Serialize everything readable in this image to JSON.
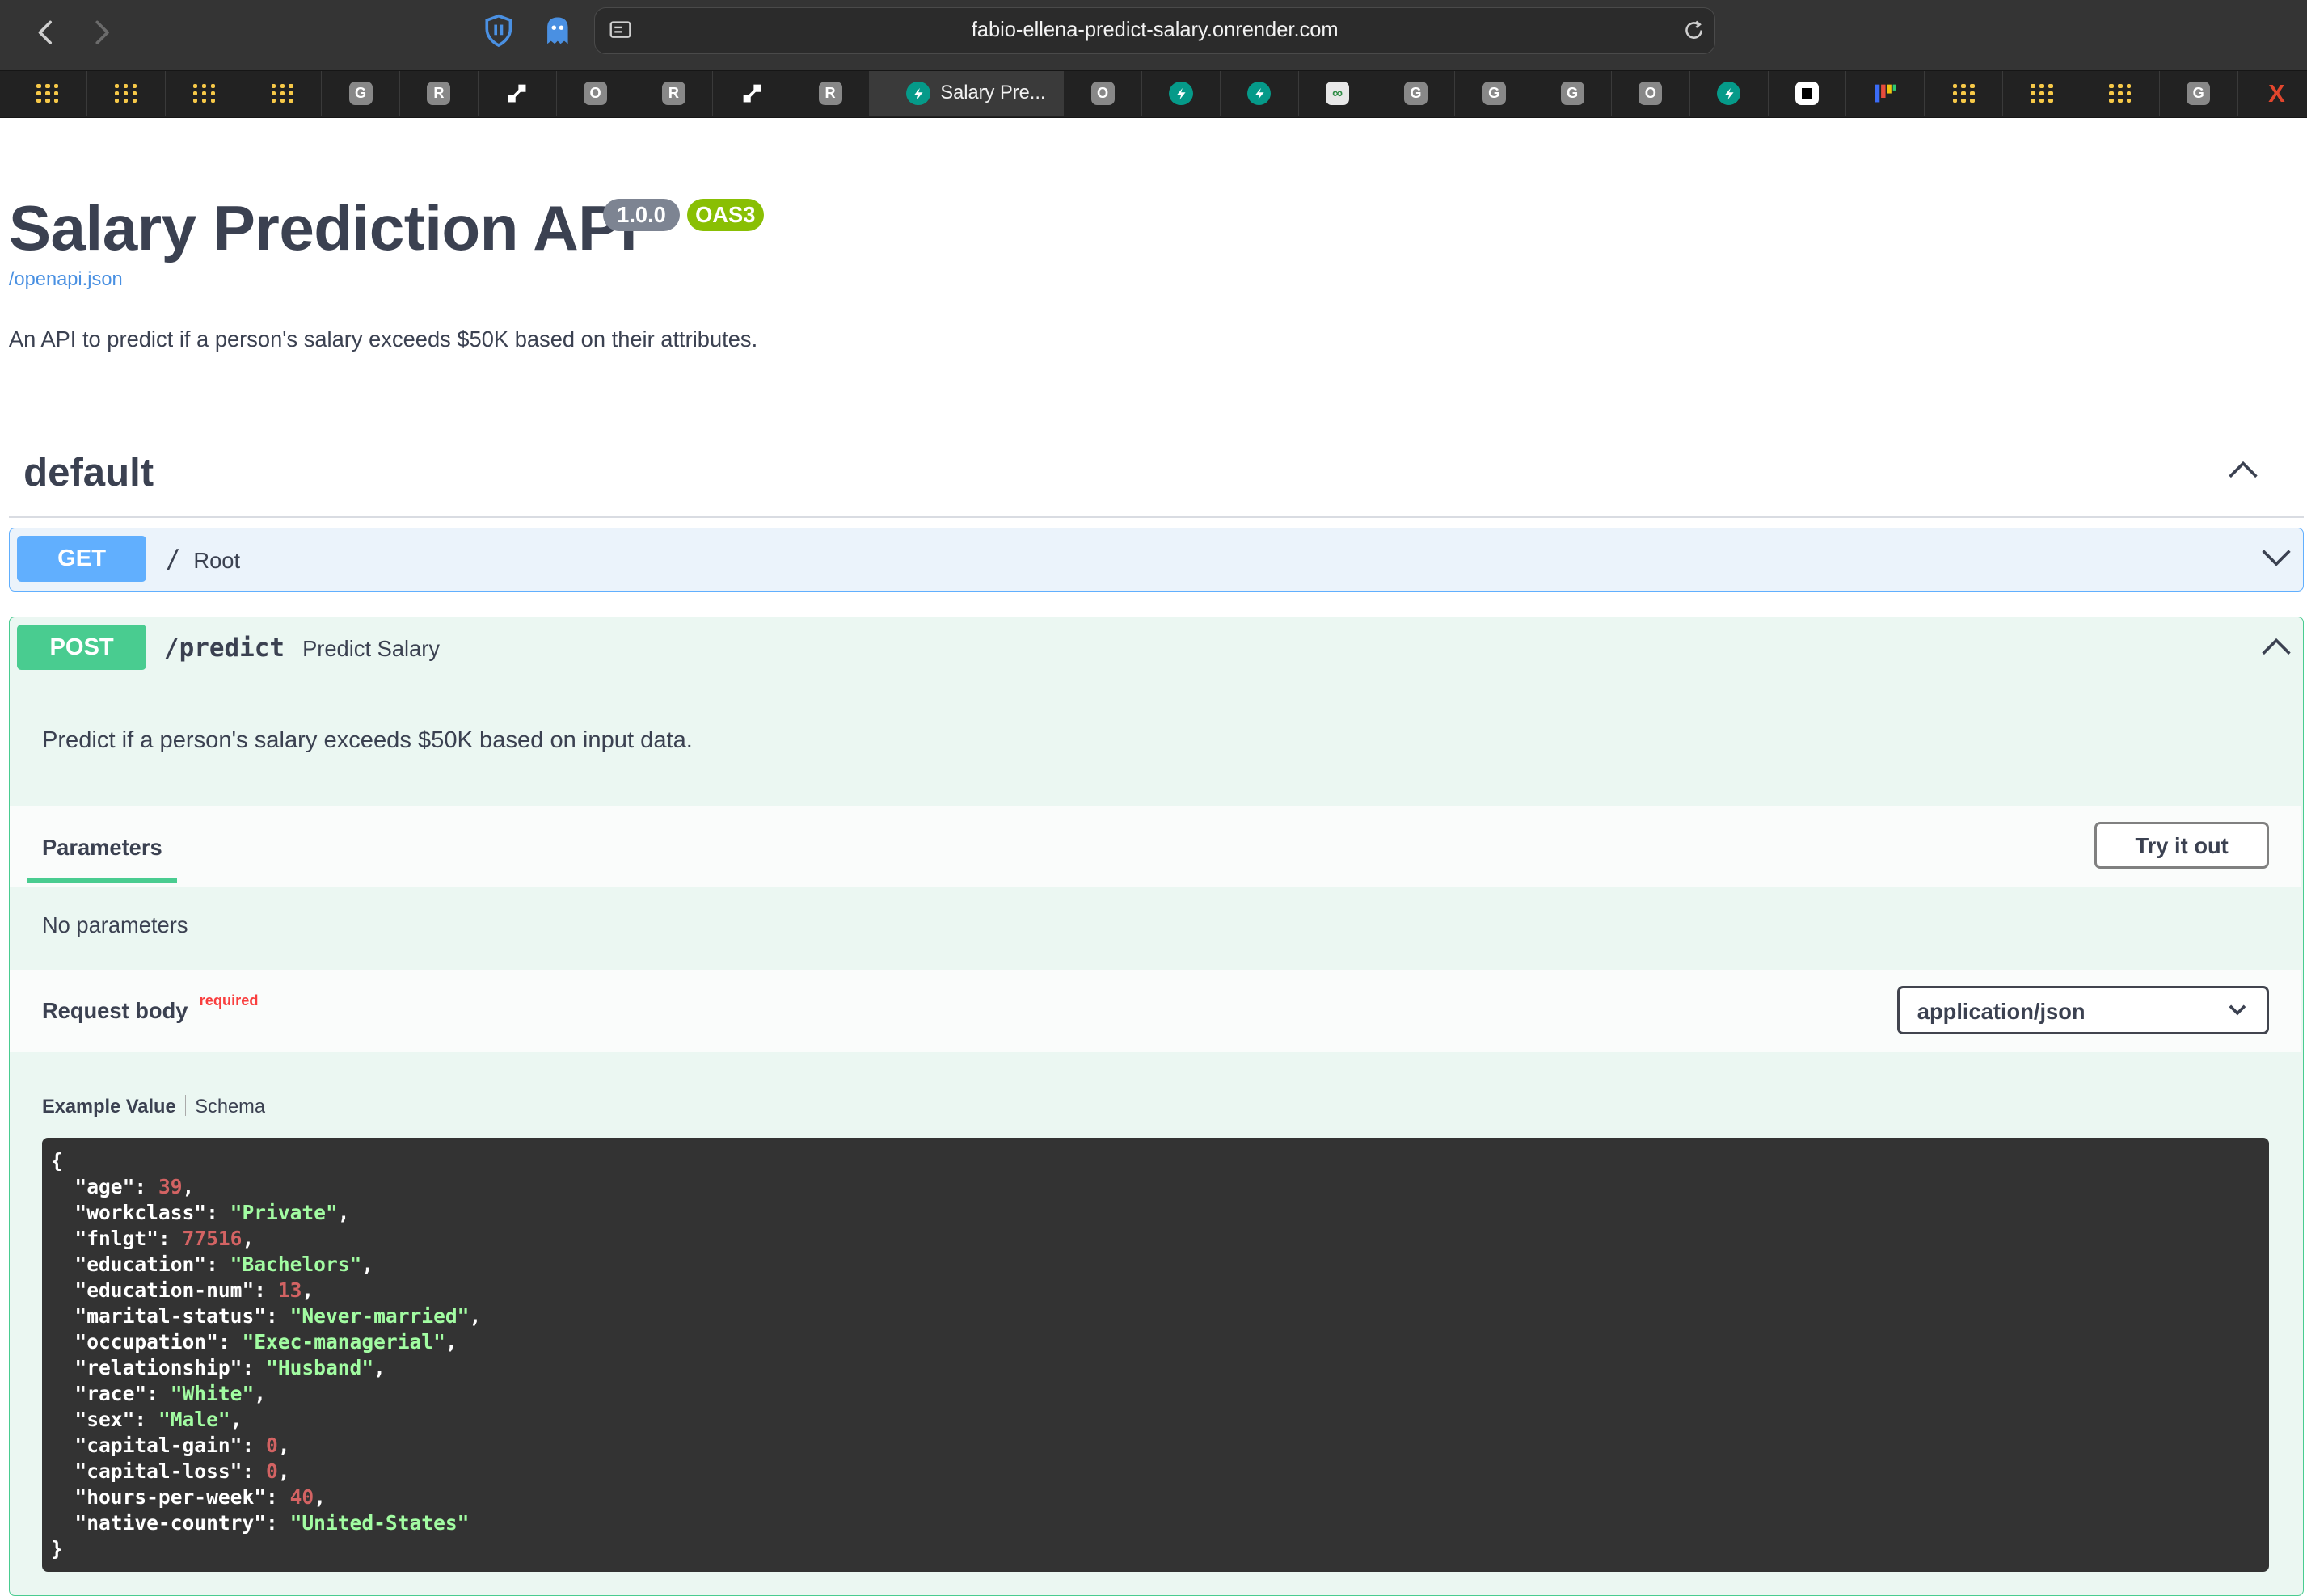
{
  "browser": {
    "url": "fabio-ellena-predict-salary.onrender.com",
    "tabs": [
      {
        "type": "dots"
      },
      {
        "type": "dots"
      },
      {
        "type": "dots"
      },
      {
        "type": "dots"
      },
      {
        "type": "letter",
        "text": "G"
      },
      {
        "type": "letter",
        "text": "R"
      },
      {
        "type": "link"
      },
      {
        "type": "letter",
        "text": "O"
      },
      {
        "type": "letter",
        "text": "R"
      },
      {
        "type": "link"
      },
      {
        "type": "letter",
        "text": "R"
      },
      {
        "type": "fastapi",
        "title": "Salary Pre...",
        "active": true
      },
      {
        "type": "letter",
        "text": "O"
      },
      {
        "type": "fastapi"
      },
      {
        "type": "fastapi"
      },
      {
        "type": "geeks"
      },
      {
        "type": "letter",
        "text": "G"
      },
      {
        "type": "letter",
        "text": "G"
      },
      {
        "type": "letter",
        "text": "G"
      },
      {
        "type": "letter",
        "text": "O"
      },
      {
        "type": "fastapi"
      },
      {
        "type": "square"
      },
      {
        "type": "bars"
      },
      {
        "type": "dots"
      },
      {
        "type": "dots"
      },
      {
        "type": "dots"
      },
      {
        "type": "letter",
        "text": "G"
      },
      {
        "type": "x",
        "text": "X"
      }
    ],
    "active_tab_title": "Salary Pre..."
  },
  "info": {
    "title": "Salary Prediction API",
    "version": "1.0.0",
    "oas": "OAS3",
    "spec_link": "/openapi.json",
    "description": "An API to predict if a person's salary exceeds $50K based on their attributes."
  },
  "section": {
    "title": "default"
  },
  "get_op": {
    "method": "GET",
    "path": "/",
    "summary": "Root"
  },
  "post_op": {
    "method": "POST",
    "path": "/predict",
    "summary": "Predict Salary",
    "description": "Predict if a person's salary exceeds $50K based on input data.",
    "parameters_tab": "Parameters",
    "try_it_out": "Try it out",
    "no_parameters": "No parameters",
    "request_body_label": "Request body",
    "required_label": "required",
    "content_type": "application/json",
    "example_tab": "Example Value",
    "schema_tab": "Schema",
    "example": [
      {
        "key": "age",
        "value": "39",
        "kind": "number"
      },
      {
        "key": "workclass",
        "value": "Private",
        "kind": "string"
      },
      {
        "key": "fnlgt",
        "value": "77516",
        "kind": "number"
      },
      {
        "key": "education",
        "value": "Bachelors",
        "kind": "string"
      },
      {
        "key": "education-num",
        "value": "13",
        "kind": "number"
      },
      {
        "key": "marital-status",
        "value": "Never-married",
        "kind": "string"
      },
      {
        "key": "occupation",
        "value": "Exec-managerial",
        "kind": "string"
      },
      {
        "key": "relationship",
        "value": "Husband",
        "kind": "string"
      },
      {
        "key": "race",
        "value": "White",
        "kind": "string"
      },
      {
        "key": "sex",
        "value": "Male",
        "kind": "string"
      },
      {
        "key": "capital-gain",
        "value": "0",
        "kind": "number"
      },
      {
        "key": "capital-loss",
        "value": "0",
        "kind": "number"
      },
      {
        "key": "hours-per-week",
        "value": "40",
        "kind": "number"
      },
      {
        "key": "native-country",
        "value": "United-States",
        "kind": "string"
      }
    ]
  },
  "colors": {
    "get": "#61affe",
    "post": "#49cc90",
    "version_badge": "#7d8492",
    "oas_badge": "#89bf04",
    "link": "#4990e2",
    "required": "#f93e3e",
    "code_bg": "#333333"
  }
}
